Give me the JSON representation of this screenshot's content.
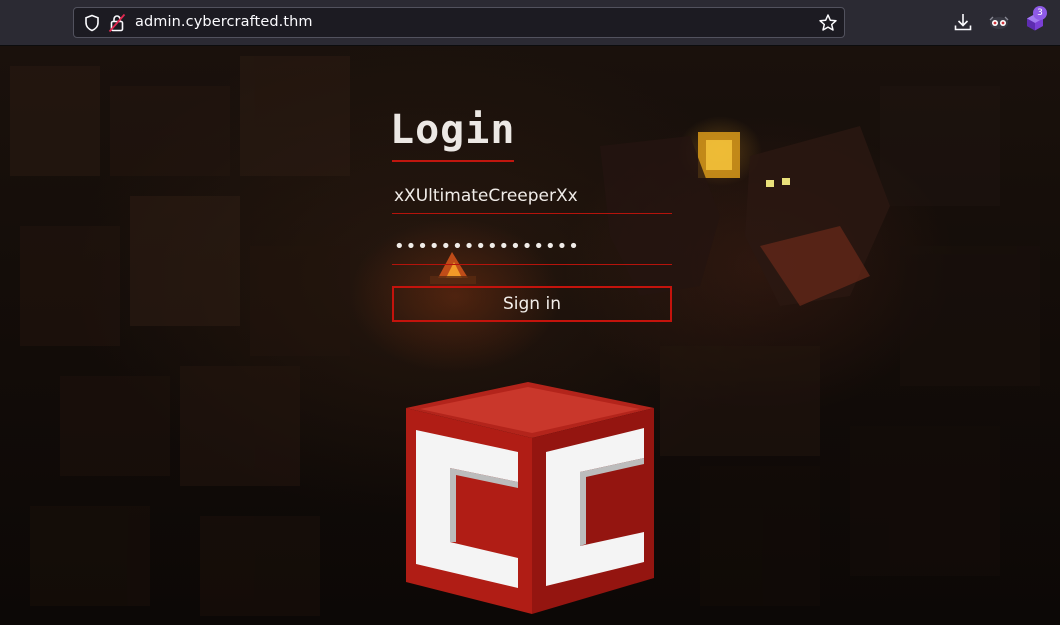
{
  "browser": {
    "url": "admin.cybercrafted.thm",
    "extensions_badge": "3",
    "icons": [
      "shield-icon",
      "lock-icon",
      "bookmark-star-icon",
      "download-icon",
      "extension-mask-icon",
      "extension-cube-icon"
    ]
  },
  "login": {
    "title": "Login",
    "username_value": "xXUltimateCreeperXx",
    "password_value": "••••••••••••••••",
    "signin_label": "Sign in"
  },
  "logo": {
    "letters": "CC"
  },
  "colors": {
    "accent_red": "#c4130c",
    "text_light": "#f0ece8",
    "toolbar_bg": "#2b2a33",
    "urlbar_bg": "#1c1b22"
  }
}
